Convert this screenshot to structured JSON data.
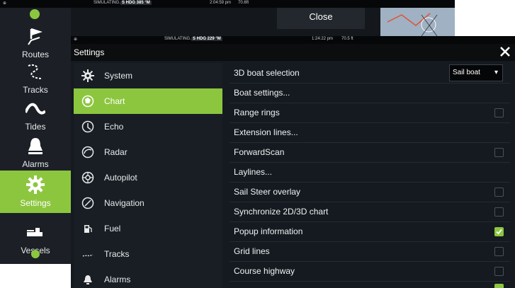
{
  "background_screen": {
    "status": {
      "simulating": "SIMULATING...",
      "heading": "S HDG 385 °M",
      "time": "2:04:59 pm",
      "depth": "70.6ft"
    },
    "close_label": "Close",
    "nav": [
      {
        "label": "Routes",
        "icon": "routes-icon"
      },
      {
        "label": "Tracks",
        "icon": "tracks-icon"
      },
      {
        "label": "Tides",
        "icon": "tides-icon"
      },
      {
        "label": "Alarms",
        "icon": "alarm-bell-icon"
      },
      {
        "label": "Settings",
        "icon": "gear-icon"
      },
      {
        "label": "Vessels",
        "icon": "vessels-icon"
      }
    ]
  },
  "settings": {
    "status": {
      "simulating": "SIMULATING...",
      "heading": "S HDG 229 °M",
      "time": "1:24:22 pm",
      "depth": "70.5 ft"
    },
    "title": "Settings",
    "categories": [
      {
        "label": "System",
        "icon": "gear-icon"
      },
      {
        "label": "Chart",
        "icon": "chart-icon"
      },
      {
        "label": "Echo",
        "icon": "echo-icon"
      },
      {
        "label": "Radar",
        "icon": "radar-icon"
      },
      {
        "label": "Autopilot",
        "icon": "autopilot-icon"
      },
      {
        "label": "Navigation",
        "icon": "navigation-icon"
      },
      {
        "label": "Fuel",
        "icon": "fuel-icon"
      },
      {
        "label": "Tracks",
        "icon": "tracks-icon"
      },
      {
        "label": "Alarms",
        "icon": "alarm-bell-icon"
      }
    ],
    "active_category": "Chart",
    "options": [
      {
        "label": "3D boat selection",
        "type": "select",
        "value": "Sail boat"
      },
      {
        "label": "Boat settings...",
        "type": "link"
      },
      {
        "label": "Range rings",
        "type": "checkbox",
        "checked": false
      },
      {
        "label": "Extension lines...",
        "type": "link"
      },
      {
        "label": "ForwardScan",
        "type": "checkbox",
        "checked": false
      },
      {
        "label": "Laylines...",
        "type": "link"
      },
      {
        "label": "Sail Steer overlay",
        "type": "checkbox",
        "checked": false
      },
      {
        "label": "Synchronize 2D/3D chart",
        "type": "checkbox",
        "checked": false
      },
      {
        "label": "Popup information",
        "type": "checkbox",
        "checked": true
      },
      {
        "label": "Grid lines",
        "type": "checkbox",
        "checked": false
      },
      {
        "label": "Course highway",
        "type": "checkbox",
        "checked": false
      }
    ]
  },
  "colors": {
    "accent": "#8cc63f",
    "panel": "#141a20",
    "header": "#0b0d0f"
  }
}
